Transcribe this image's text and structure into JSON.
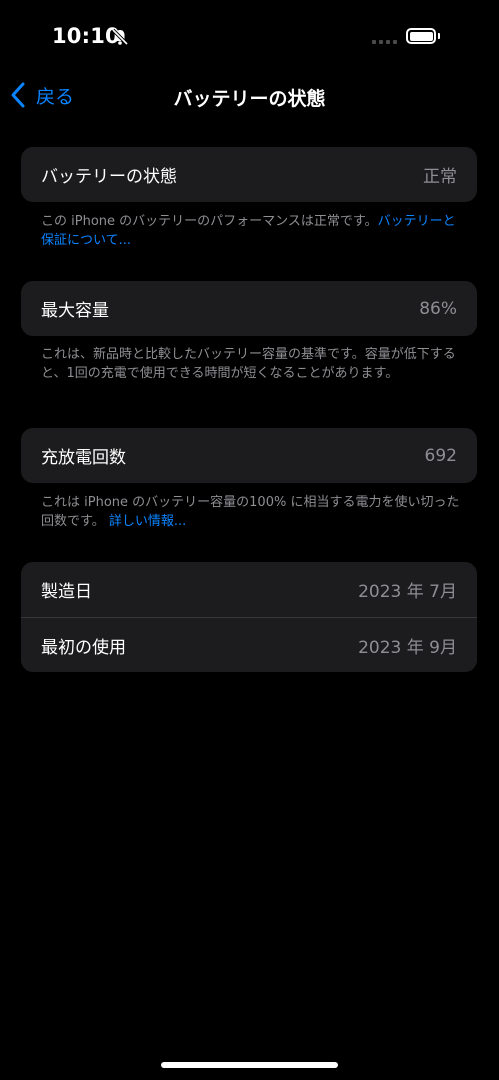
{
  "status_bar": {
    "time": "10:10"
  },
  "nav": {
    "back_label": "戻る",
    "title": "バッテリーの状態"
  },
  "health": {
    "label": "バッテリーの状態",
    "value": "正常"
  },
  "health_note": {
    "text": "この iPhone のバッテリーのパフォーマンスは正常です。",
    "link": "バッテリーと保証について..."
  },
  "capacity": {
    "label": "最大容量",
    "value": "86%"
  },
  "capacity_note": {
    "text": "これは、新品時と比較したバッテリー容量の基準です。容量が低下すると、1回の充電で使用できる時間が短くなることがあります。"
  },
  "cycles": {
    "label": "充放電回数",
    "value": "692"
  },
  "cycles_note": {
    "text": "これは iPhone のバッテリー容量の100% に相当する電力を使い切った回数です。",
    "link": "詳しい情報..."
  },
  "dates": {
    "manufacture_label": "製造日",
    "manufacture_value": "2023 年 7月",
    "first_use_label": "最初の使用",
    "first_use_value": "2023 年 9月"
  },
  "icons": {
    "bell": "bell-slash-icon",
    "back": "chevron-left-icon",
    "battery": "battery-icon",
    "signal": "signal-icon"
  },
  "colors": {
    "accent": "#0a84ff",
    "card": "#1c1c1e",
    "secondary_text": "#8e8e93",
    "background": "#000000"
  }
}
